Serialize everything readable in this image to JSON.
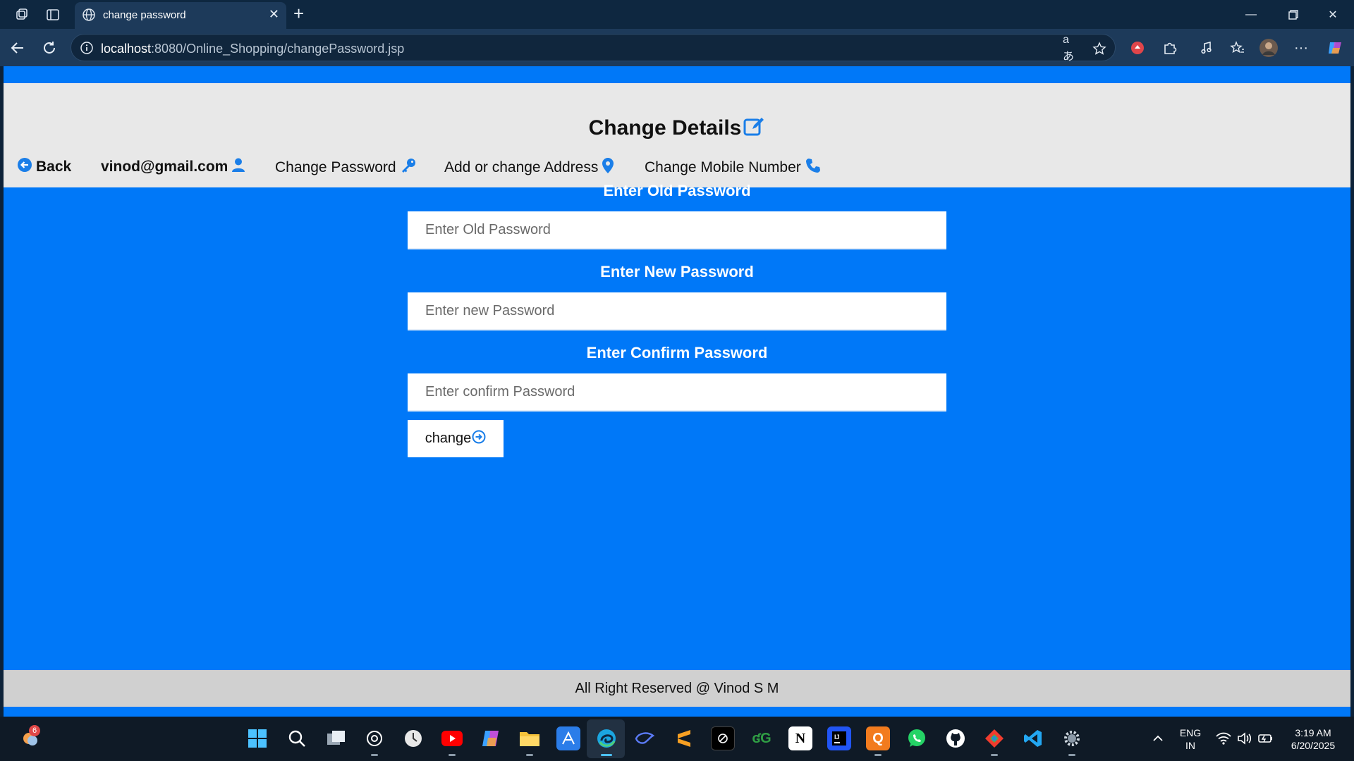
{
  "browser": {
    "tab_title": "change password",
    "url_host": "localhost",
    "url_rest": ":8080/Online_Shopping/changePassword.jsp"
  },
  "page": {
    "title": "Change Details",
    "nav": {
      "back": "Back",
      "email": "vinod@gmail.com",
      "change_password": "Change Password",
      "address": "Add or change Address",
      "mobile": "Change Mobile Number"
    },
    "form": {
      "old_label": "Enter Old Password",
      "old_placeholder": "Enter Old Password",
      "new_label": "Enter New Password",
      "new_placeholder": "Enter new Password",
      "confirm_label": "Enter Confirm Password",
      "confirm_placeholder": "Enter confirm Password",
      "submit": "change"
    },
    "footer": "All Right Reserved @ Vinod S M"
  },
  "taskbar": {
    "notification_count": "6",
    "lang_line1": "ENG",
    "lang_line2": "IN",
    "time": "3:19 AM",
    "date": "6/20/2025"
  },
  "colors": {
    "page_bg": "#0078f8",
    "header_bg": "#e8e8e8",
    "footer_bg": "#d0d0d0",
    "accent_icon": "#1a7ee8"
  }
}
